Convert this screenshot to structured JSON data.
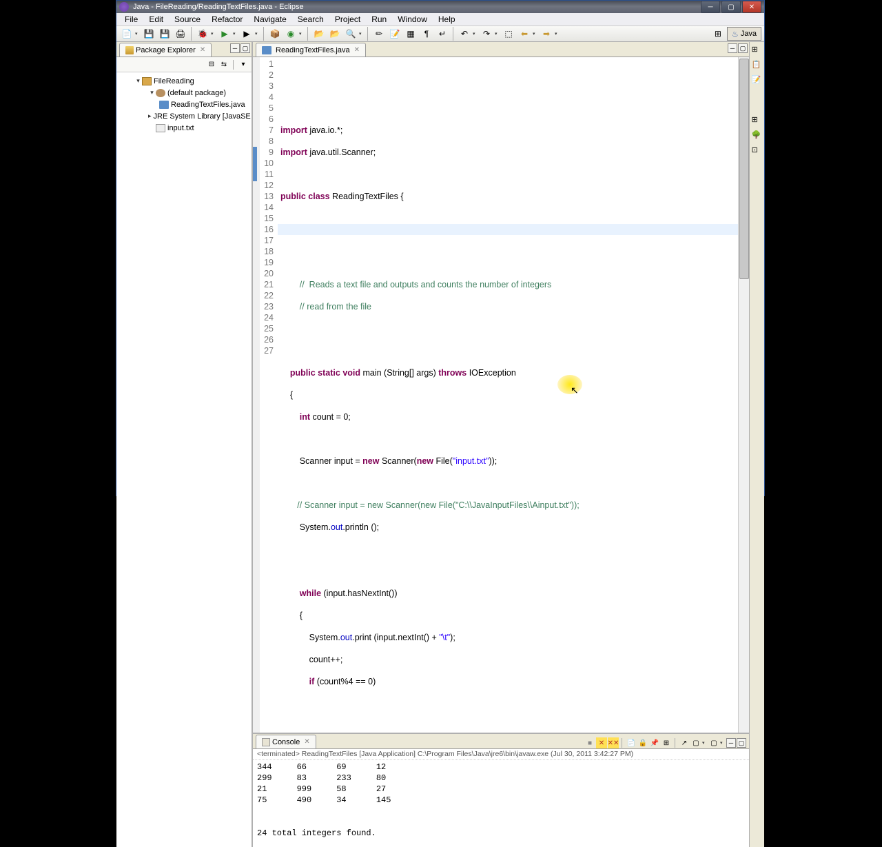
{
  "title": "Java - FileReading/ReadingTextFiles.java - Eclipse",
  "menu": [
    "File",
    "Edit",
    "Source",
    "Refactor",
    "Navigate",
    "Search",
    "Project",
    "Run",
    "Window",
    "Help"
  ],
  "perspective": "Java",
  "packageExplorer": {
    "title": "Package Explorer",
    "items": {
      "project": "FileReading",
      "pkg": "(default package)",
      "file": "ReadingTextFiles.java",
      "lib": "JRE System Library [JavaSE",
      "txt": "input.txt"
    }
  },
  "editor": {
    "tab": "ReadingTextFiles.java",
    "lineNumbers": [
      "1",
      "2",
      "3",
      "4",
      "5",
      "6",
      "7",
      "8",
      "9",
      "10",
      "11",
      "12",
      "13",
      "14",
      "15",
      "16",
      "17",
      "18",
      "19",
      "20",
      "21",
      "22",
      "23",
      "24",
      "25",
      "26",
      "27"
    ],
    "code": {
      "l2a": "import",
      "l2b": " java.io.*;",
      "l3a": "import",
      "l3b": " java.util.Scanner;",
      "l5a": "public",
      "l5b": " class",
      "l5c": " ReadingTextFiles {",
      "l9": "        //  Reads a text file and outputs and counts the number of integers",
      "l10": "        // read from the file",
      "l13a": "    public",
      "l13b": " static",
      "l13c": " void",
      "l13d": " main (String[] args) ",
      "l13e": "throws",
      "l13f": " IOException",
      "l14": "    {",
      "l15a": "        int",
      "l15b": " count = 0;",
      "l17a": "        Scanner input = ",
      "l17b": "new",
      "l17c": " Scanner(",
      "l17d": "new",
      "l17e": " File(",
      "l17f": "\"input.txt\"",
      "l17g": "));",
      "l19": "       // Scanner input = new Scanner(new File(\"C:\\\\JavaInputFiles\\\\Ainput.txt\"));",
      "l20a": "        System.",
      "l20b": "out",
      "l20c": ".println ();",
      "l23a": "        while",
      "l23b": " (input.hasNextInt())",
      "l24": "        {",
      "l25a": "            System.",
      "l25b": "out",
      "l25c": ".print (input.nextInt() + ",
      "l25d": "\"\\t\"",
      "l25e": ");",
      "l26": "            count++;",
      "l27a": "            if",
      "l27b": " (count%4 == 0)"
    }
  },
  "console": {
    "title": "Console",
    "header": "<terminated> ReadingTextFiles [Java Application] C:\\Program Files\\Java\\jre6\\bin\\javaw.exe (Jul 30, 2011 3:42:27 PM)",
    "output": "344     66      69      12\n299     83      233     80\n21      999     58      27\n75      490     34      145\n\n\n24 total integers found."
  }
}
